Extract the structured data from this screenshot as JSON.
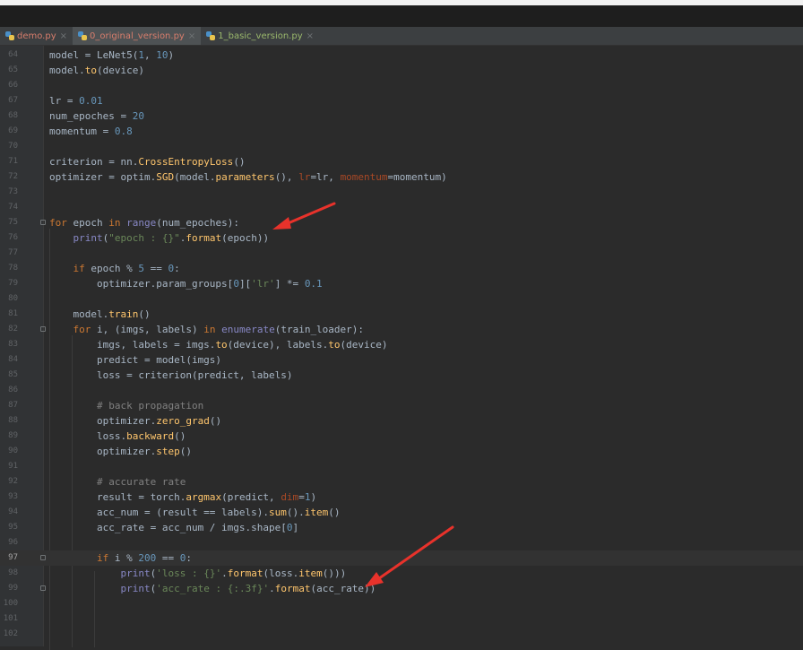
{
  "tabs": [
    {
      "name": "demo.py",
      "style": "red"
    },
    {
      "name": "0_original_version.py",
      "style": "red",
      "active": true
    },
    {
      "name": "1_basic_version.py",
      "style": "green"
    }
  ],
  "editor": {
    "current_line": 97,
    "lines": [
      {
        "n": "64",
        "html": "model = LeNet5(1, 10)"
      },
      {
        "n": "65",
        "html": "model.to(device)"
      },
      {
        "n": "66",
        "html": ""
      },
      {
        "n": "67",
        "html": "lr = 0.01"
      },
      {
        "n": "68",
        "html": "num_epoches = 20"
      },
      {
        "n": "69",
        "html": "momentum = 0.8"
      },
      {
        "n": "70",
        "html": ""
      },
      {
        "n": "71",
        "html": "criterion = nn.CrossEntropyLoss()"
      },
      {
        "n": "72",
        "html": "optimizer = optim.SGD(model.parameters(), lr=lr, momentum=momentum)"
      },
      {
        "n": "73",
        "html": ""
      },
      {
        "n": "74",
        "html": ""
      },
      {
        "n": "75",
        "html": "for epoch in range(num_epoches):"
      },
      {
        "n": "76",
        "html": "    print(\"epoch : {}\".format(epoch))"
      },
      {
        "n": "77",
        "html": ""
      },
      {
        "n": "78",
        "html": "    if epoch % 5 == 0:"
      },
      {
        "n": "79",
        "html": "        optimizer.param_groups[0]['lr'] *= 0.1"
      },
      {
        "n": "80",
        "html": ""
      },
      {
        "n": "81",
        "html": "    model.train()"
      },
      {
        "n": "82",
        "html": "    for i, (imgs, labels) in enumerate(train_loader):"
      },
      {
        "n": "83",
        "html": "        imgs, labels = imgs.to(device), labels.to(device)"
      },
      {
        "n": "84",
        "html": "        predict = model(imgs)"
      },
      {
        "n": "85",
        "html": "        loss = criterion(predict, labels)"
      },
      {
        "n": "86",
        "html": ""
      },
      {
        "n": "87",
        "html": "        # back propagation"
      },
      {
        "n": "88",
        "html": "        optimizer.zero_grad()"
      },
      {
        "n": "89",
        "html": "        loss.backward()"
      },
      {
        "n": "90",
        "html": "        optimizer.step()"
      },
      {
        "n": "91",
        "html": ""
      },
      {
        "n": "92",
        "html": "        # accurate rate"
      },
      {
        "n": "93",
        "html": "        result = torch.argmax(predict, dim=1)"
      },
      {
        "n": "94",
        "html": "        acc_num = (result == labels).sum().item()"
      },
      {
        "n": "95",
        "html": "        acc_rate = acc_num / imgs.shape[0]"
      },
      {
        "n": "96",
        "html": ""
      },
      {
        "n": "97",
        "html": "        if i % 200 == 0:"
      },
      {
        "n": "98",
        "html": "            print('loss : {}'.format(loss.item()))"
      },
      {
        "n": "99",
        "html": "            print('acc_rate : {:.3f}'.format(acc_rate))"
      },
      {
        "n": "100",
        "html": ""
      },
      {
        "n": "101",
        "html": ""
      },
      {
        "n": "102",
        "html": ""
      }
    ]
  },
  "colors": {
    "background": "#2b2b2b",
    "gutter": "#313335",
    "keyword": "#cc7832",
    "number": "#6897bb",
    "function": "#ffc66d",
    "builtin": "#8888c6",
    "string": "#6a8759",
    "comment": "#808080",
    "param": "#aa4926",
    "annotation_arrow": "#e8322b"
  }
}
